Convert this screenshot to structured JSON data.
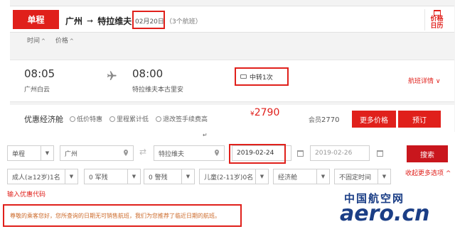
{
  "flight_result": {
    "trip_type": "单程",
    "origin": "广州",
    "destination": "特拉维夫",
    "date": "02月20日",
    "flight_count": "（3个航班）",
    "calendar_label_1": "价格",
    "calendar_label_2": "日历",
    "sort_time": "时间",
    "sort_price": "价格",
    "sort_chevron": "^",
    "departure_time": "08:05",
    "departure_airport": "广州白云",
    "arrival_time": "08:00",
    "arrival_airport": "特拉维夫本古里安",
    "transfer": "中转1次",
    "detail_link": "航班详情 ∨",
    "fare_name": "优惠经济舱",
    "features": [
      "低价特惠",
      "里程累计低",
      "退改签手续费高"
    ],
    "price_symbol": "¥",
    "price": "2790",
    "member_label": "会员",
    "member_price": "2770",
    "more_price_button": "更多价格",
    "book_button": "预订"
  },
  "return_mark": "↵",
  "search_form": {
    "trip_type": "单程",
    "origin": "广州",
    "destination": "特拉维夫",
    "depart_date": "2019-02-24",
    "return_date": "2019-02-26",
    "search_button": "搜索",
    "adult": "成人(≥12岁)1名",
    "military": "0 军残",
    "police": "0 警残",
    "child": "儿童(2-11岁)0名",
    "cabin": "经济舱",
    "time": "不固定时间",
    "more_options": "收起更多选项 ^",
    "promo_code": "输入优惠代码",
    "dropdown_glyph": "▼"
  },
  "notice": "尊敬的乘客您好，您所查询的日期无可销售航班，我们为您推荐了临近日期的航班。",
  "watermark": {
    "chinese": "中国航空网",
    "english": "aero.cn"
  },
  "colors": {
    "brand_red": "#e0201b",
    "watermark_blue": "#1b3e86"
  }
}
